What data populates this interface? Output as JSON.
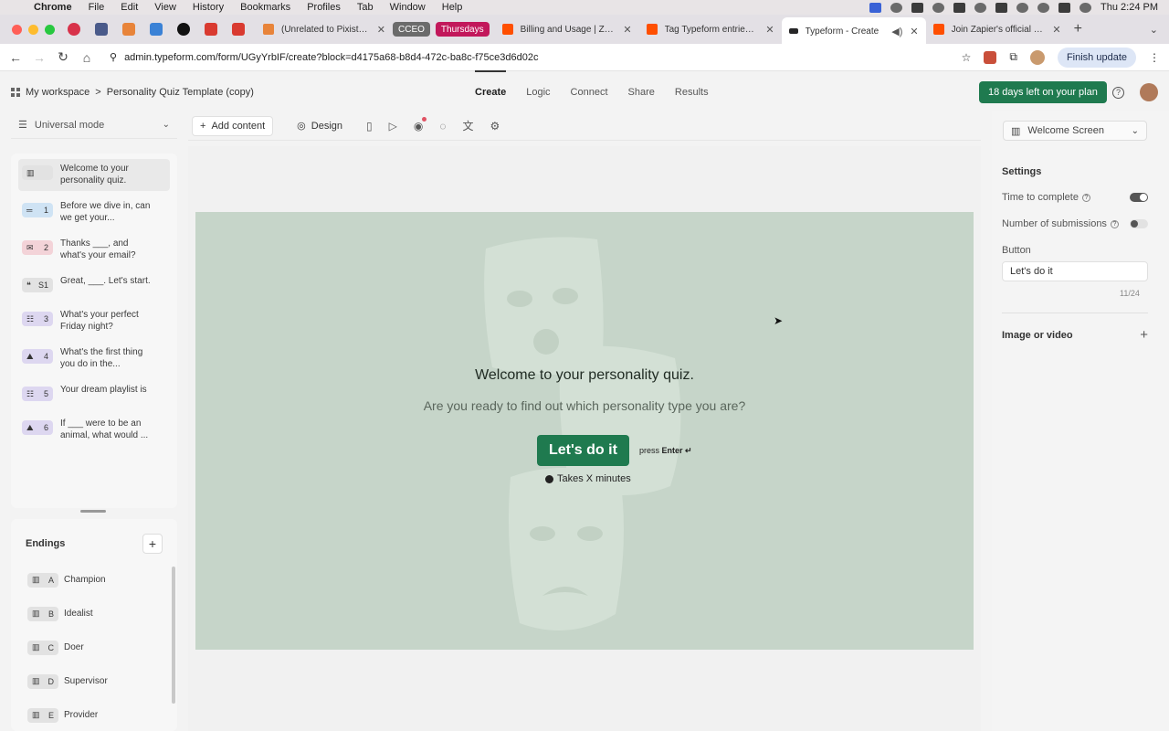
{
  "menubar": {
    "app": "Chrome",
    "items": [
      "File",
      "Edit",
      "View",
      "History",
      "Bookmarks",
      "Profiles",
      "Tab",
      "Window",
      "Help"
    ],
    "clock": "Thu 2:24 PM"
  },
  "tabs": {
    "pinned_icons": [
      "record-icon",
      "app-icon",
      "pixistock-icon",
      "calendar-icon",
      "threads-icon",
      "gmail-icon",
      "gmail-icon"
    ],
    "tab_unrelated": "(Unrelated to Pixistock) Ki",
    "group_ceo": "CCEO",
    "group_thursdays": "Thursdays",
    "tab_billing": "Billing and Usage | Zapier",
    "tab_tag": "Tag Typeform entries in Kit",
    "tab_typeform": "Typeform - Create",
    "tab_join": "Join Zapier's official Partn",
    "colors": {
      "ceo": "#6b6b6b",
      "thursdays": "#c2185b",
      "zapier": "#ff4f00"
    }
  },
  "address": {
    "url": "admin.typeform.com/form/UGyYrbIF/create?block=d4175a68-b8d4-472c-ba8c-f75ce3d6d02c",
    "finish_update": "Finish update"
  },
  "header": {
    "workspace": "My workspace",
    "separator": ">",
    "form_title": "Personality Quiz Template (copy)",
    "nav": [
      "Create",
      "Logic",
      "Connect",
      "Share",
      "Results"
    ],
    "trial_button": "18 days left on your plan"
  },
  "sidebar": {
    "mode": "Universal mode",
    "questions": [
      {
        "num": "",
        "icon": "welcome-screen-icon",
        "color": "#e2e2e2",
        "text": "Welcome to your personality quiz."
      },
      {
        "num": "1",
        "icon": "short-text-icon",
        "color": "#cfe3f4",
        "text": "Before we dive in, can we get your..."
      },
      {
        "num": "2",
        "icon": "email-icon",
        "color": "#f3d3d8",
        "text": "Thanks ___, and what's your email?"
      },
      {
        "num": "S1",
        "icon": "quote-icon",
        "color": "#e2e2e2",
        "text": "Great, ___. Let's start."
      },
      {
        "num": "3",
        "icon": "multiple-choice-icon",
        "color": "#ddd7f0",
        "text": "What's your perfect Friday night?"
      },
      {
        "num": "4",
        "icon": "picture-choice-icon",
        "color": "#ddd7f0",
        "text": "What's the first thing you do in the..."
      },
      {
        "num": "5",
        "icon": "multiple-choice-icon",
        "color": "#ddd7f0",
        "text": "Your dream playlist is"
      },
      {
        "num": "6",
        "icon": "picture-choice-icon",
        "color": "#ddd7f0",
        "text": "If ___ were to be an animal, what would ..."
      }
    ],
    "endings_title": "Endings",
    "endings": [
      {
        "letter": "A",
        "label": "Champion"
      },
      {
        "letter": "B",
        "label": "Idealist"
      },
      {
        "letter": "C",
        "label": "Doer"
      },
      {
        "letter": "D",
        "label": "Supervisor"
      },
      {
        "letter": "E",
        "label": "Provider"
      }
    ]
  },
  "toolbar": {
    "add_content": "Add content",
    "design": "Design"
  },
  "canvas": {
    "title": "Welcome to your personality quiz.",
    "subtitle": "Are you ready to find out which personality type you are?",
    "button": "Let's do it",
    "press": "press",
    "enter": "Enter ↵",
    "takes": "Takes X minutes",
    "bg_color": "#c6d5c9",
    "button_color": "#1f7a4f"
  },
  "right_panel": {
    "screen": "Welcome Screen",
    "settings": "Settings",
    "time_to_complete": "Time to complete",
    "time_to_complete_on": true,
    "num_submissions": "Number of submissions",
    "num_submissions_on": false,
    "button_label": "Button",
    "button_value": "Let's do it",
    "char_count": "11/24",
    "image_or_video": "Image or video"
  }
}
